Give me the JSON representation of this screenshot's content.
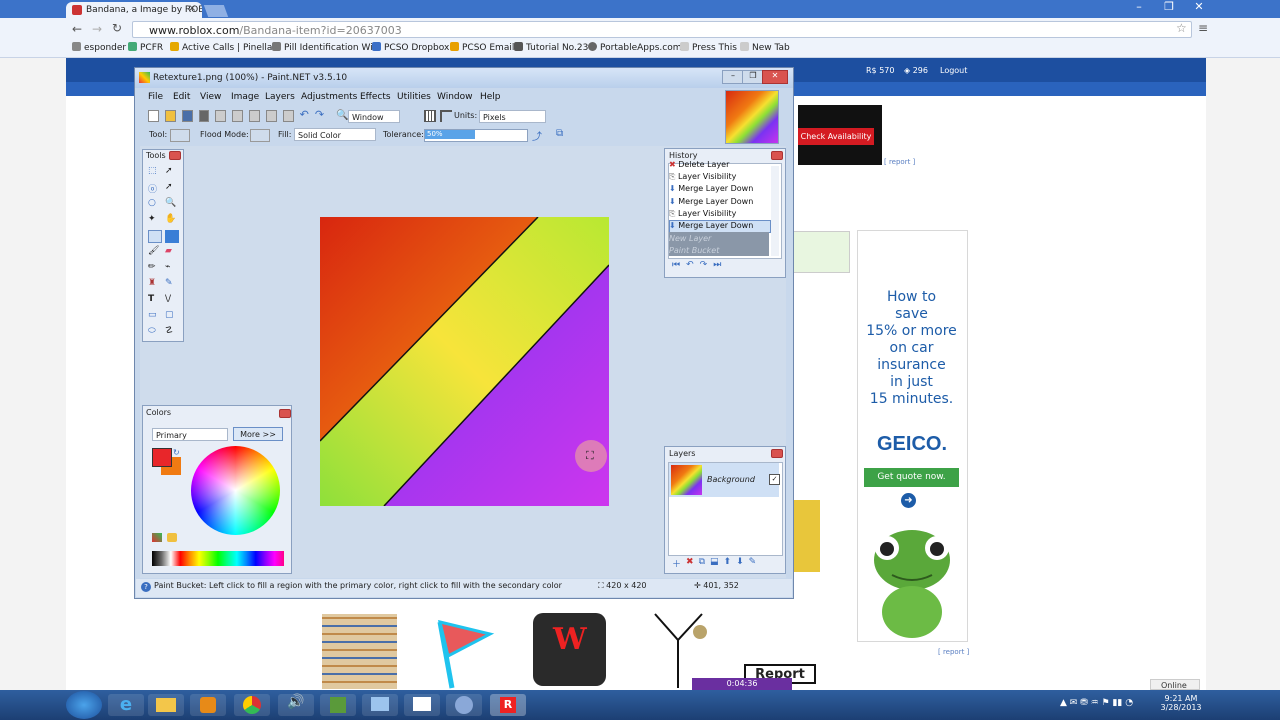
{
  "browser": {
    "tab_title": "Bandana, a Image by ROB",
    "url_host": "www.roblox.com",
    "url_path": "/Bandana-item?id=20637003",
    "bookmarks": [
      "esponder",
      "PCFR",
      "Active Calls | Pinella...",
      "Pill Identification Wi...",
      "PCSO Dropbox",
      "PCSO Email",
      "Tutorial No.23",
      "PortableApps.com",
      "Press This",
      "New Tab"
    ]
  },
  "roblox": {
    "robux": "570",
    "tickets": "296",
    "logout": "Logout",
    "check_availability": "Check Availability",
    "report": "[ report ]",
    "report_button": "Report",
    "online": "Online",
    "timer": "0:04:36"
  },
  "geico_ad": {
    "lines": [
      "How to",
      "save",
      "15% or more",
      "on car",
      "insurance",
      "in just",
      "15 minutes."
    ],
    "logo": "GEICO.",
    "cta": "Get quote now."
  },
  "paintnet": {
    "title": "Retexture1.png (100%) - Paint.NET v3.5.10",
    "menu": [
      "File",
      "Edit",
      "View",
      "Image",
      "Layers",
      "Adjustments",
      "Effects",
      "Utilities",
      "Window",
      "Help"
    ],
    "toolbar": {
      "zoom_combo": "Window",
      "units_label": "Units:",
      "units_value": "Pixels",
      "tool_label": "Tool:",
      "flood_label": "Flood Mode:",
      "fill_label": "Fill:",
      "fill_value": "Solid Color",
      "tolerance_label": "Tolerance:",
      "tolerance_value": "50%"
    },
    "tools_title": "Tools",
    "colors": {
      "title": "Colors",
      "mode": "Primary",
      "more_button": "More >>",
      "primary": "#e8262a",
      "secondary": "#f07a12"
    },
    "history": {
      "title": "History",
      "items": [
        "Delete Layer",
        "Layer Visibility",
        "Merge Layer Down",
        "Merge Layer Down",
        "Layer Visibility",
        "Merge Layer Down",
        "New Layer",
        "Paint Bucket"
      ],
      "selected_index": 5
    },
    "layers": {
      "title": "Layers",
      "items": [
        "Background"
      ]
    },
    "status": {
      "hint": "Paint Bucket: Left click to fill a region with the primary color, right click to fill with the secondary color",
      "size": "420 x 420",
      "cursor": "401, 352"
    }
  },
  "taskbar": {
    "time": "9:21 AM",
    "date": "3/28/2013"
  }
}
